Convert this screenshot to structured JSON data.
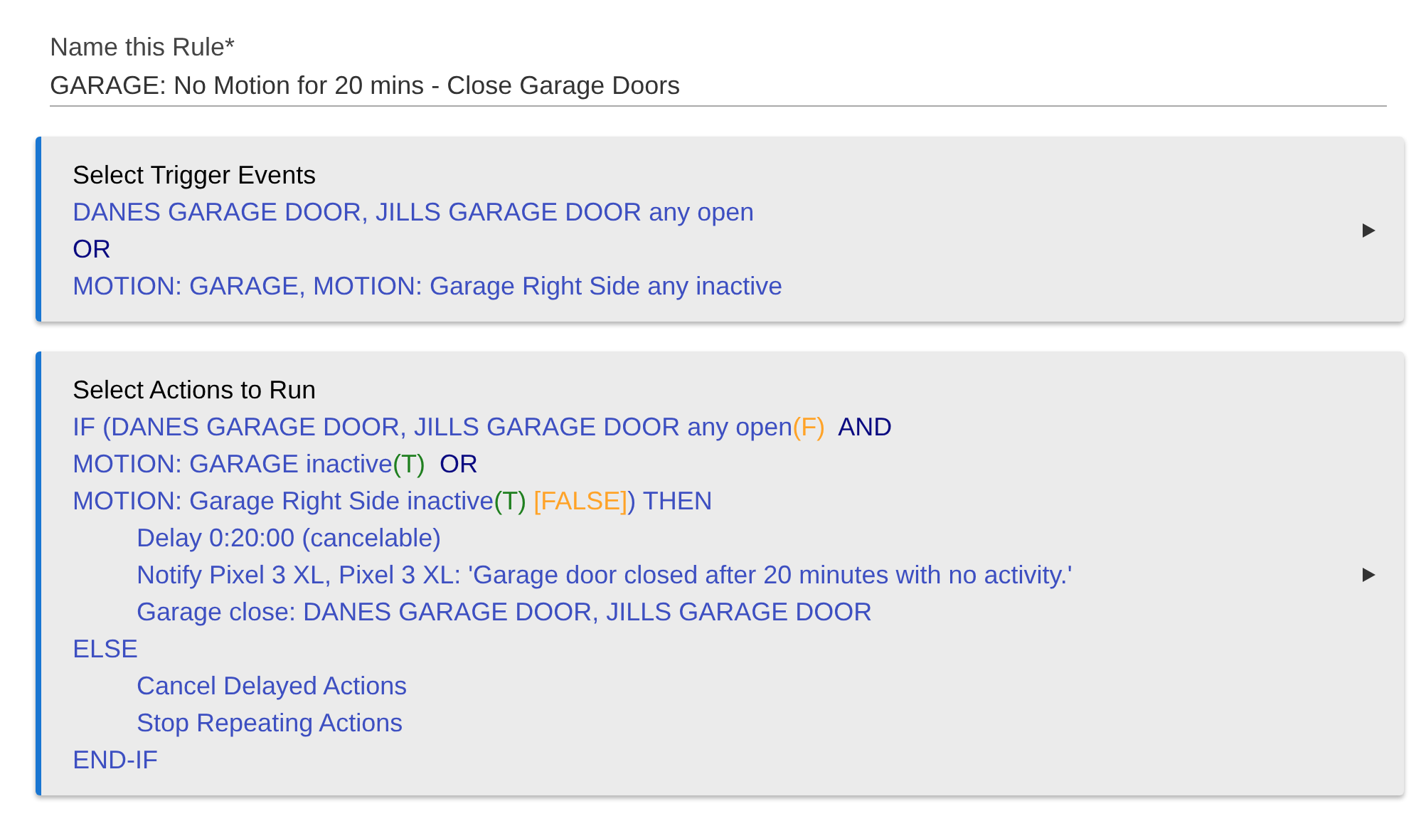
{
  "rule_name": {
    "label": "Name this Rule*",
    "value": "GARAGE: No Motion for 20 mins - Close Garage Doors"
  },
  "sections": [
    {
      "title": "Select Trigger Events",
      "lines": [
        {
          "parts": [
            {
              "kind": "device",
              "text": "DANES GARAGE DOOR, JILLS GARAGE DOOR any open"
            }
          ]
        },
        {
          "parts": [
            {
              "kind": "logic",
              "text": "OR"
            }
          ]
        },
        {
          "parts": [
            {
              "kind": "device",
              "text": "MOTION: GARAGE, MOTION: Garage Right Side any inactive"
            }
          ]
        }
      ]
    },
    {
      "title": "Select Actions to Run",
      "lines": [
        {
          "parts": [
            {
              "kind": "device",
              "text": "IF (DANES GARAGE DOOR, JILLS GARAGE DOOR any open"
            },
            {
              "kind": "false",
              "text": "(F)"
            },
            {
              "kind": "logic",
              "text": "  AND"
            }
          ]
        },
        {
          "parts": [
            {
              "kind": "device",
              "text": "MOTION: GARAGE inactive"
            },
            {
              "kind": "true",
              "text": "(T)"
            },
            {
              "kind": "logic",
              "text": "  OR"
            }
          ]
        },
        {
          "parts": [
            {
              "kind": "device",
              "text": "MOTION: Garage Right Side inactive"
            },
            {
              "kind": "true",
              "text": "(T) "
            },
            {
              "kind": "false",
              "text": "[FALSE]"
            },
            {
              "kind": "device",
              "text": ") THEN"
            }
          ],
          "children": [
            {
              "parts": [
                {
                  "kind": "device",
                  "text": "Delay 0:20:00 (cancelable)"
                }
              ]
            },
            {
              "parts": [
                {
                  "kind": "device",
                  "text": "Notify Pixel 3 XL, Pixel 3 XL: 'Garage door closed after 20 minutes with no activity.'"
                }
              ]
            },
            {
              "parts": [
                {
                  "kind": "device",
                  "text": "Garage close: DANES GARAGE DOOR, JILLS GARAGE DOOR"
                }
              ]
            }
          ]
        },
        {
          "parts": [
            {
              "kind": "device",
              "text": "ELSE"
            }
          ],
          "children": [
            {
              "parts": [
                {
                  "kind": "device",
                  "text": "Cancel Delayed Actions"
                }
              ]
            },
            {
              "parts": [
                {
                  "kind": "device",
                  "text": "Stop Repeating Actions"
                }
              ]
            }
          ]
        },
        {
          "parts": [
            {
              "kind": "device",
              "text": "END-IF"
            }
          ]
        }
      ]
    }
  ]
}
